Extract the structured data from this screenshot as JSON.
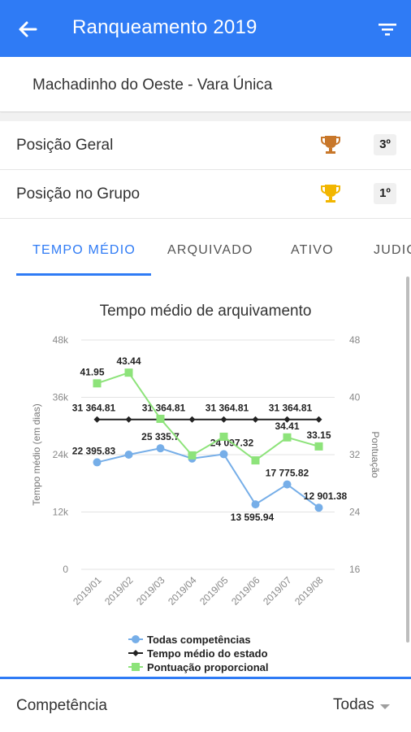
{
  "app_bar": {
    "title": "Ranqueamento 2019"
  },
  "court": {
    "name": "Machadinho do Oeste - Vara Única"
  },
  "positions": [
    {
      "label": "Posição Geral",
      "rank": "3º",
      "trophy_color": "#c8772a"
    },
    {
      "label": "Posição no Grupo",
      "rank": "1º",
      "trophy_color": "#f2b600"
    }
  ],
  "tabs": [
    {
      "label": "TEMPO MÉDIO",
      "active": true
    },
    {
      "label": "ARQUIVADO",
      "active": false
    },
    {
      "label": "ATIVO",
      "active": false
    },
    {
      "label": "JUDIC",
      "active": false
    }
  ],
  "footer": {
    "label": "Competência",
    "value": "Todas"
  },
  "colors": {
    "primary": "#2f7bf5",
    "series_todas": "#76aee8",
    "series_estado": "#222222",
    "series_pontuacao": "#8de37a"
  },
  "chart_data": {
    "type": "line",
    "title": "Tempo médio de arquivamento",
    "ylabel": "Tempo médio (em dias)",
    "y2label": "Pontuação",
    "categories": [
      "2019/01",
      "2019/02",
      "2019/03",
      "2019/04",
      "2019/05",
      "2019/06",
      "2019/07",
      "2019/08"
    ],
    "ylim": [
      0,
      48000
    ],
    "yticks": [
      "0",
      "12k",
      "24k",
      "36k",
      "48k"
    ],
    "y2lim": [
      16,
      48
    ],
    "y2ticks": [
      "16",
      "24",
      "32",
      "40",
      "48"
    ],
    "grid": true,
    "legend_position": "bottom",
    "series": [
      {
        "name": "Todas competências",
        "axis": "left",
        "color": "#76aee8",
        "marker": "circle",
        "values": [
          22395.83,
          24000,
          25335.7,
          23200,
          24097.32,
          13595.94,
          17775.82,
          12901.38
        ],
        "labels": [
          "22 395.83",
          "",
          "25 335.7",
          "",
          "24 097.32",
          "13 595.94",
          "17 775.82",
          "12 901.38"
        ]
      },
      {
        "name": "Tempo médio do estado",
        "axis": "left",
        "color": "#222222",
        "marker": "diamond",
        "values": [
          31364.81,
          31364.81,
          31364.81,
          31364.81,
          31364.81,
          31364.81,
          31364.81,
          31364.81
        ],
        "labels": [
          "31 364.81",
          "",
          "31 364.81",
          "",
          "31 364.81",
          "",
          "31 364.81",
          ""
        ]
      },
      {
        "name": "Pontuação proporcional",
        "axis": "right",
        "color": "#8de37a",
        "marker": "square",
        "values": [
          41.95,
          43.44,
          37,
          31.9,
          34.5,
          31.2,
          34.41,
          33.15
        ],
        "labels": [
          "41.95",
          "43.44",
          "",
          "",
          "",
          "",
          "34.41",
          "33.15"
        ]
      }
    ]
  }
}
